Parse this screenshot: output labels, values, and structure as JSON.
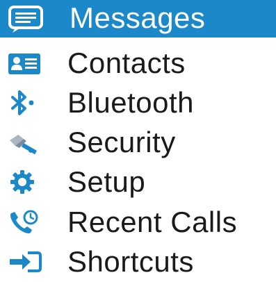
{
  "menu": {
    "accent_color": "#1b89c9",
    "icon_color": "#1b89c9",
    "items": [
      {
        "label": "Messages",
        "icon": "message-icon",
        "selected": true
      },
      {
        "label": "Contacts",
        "icon": "contact-card-icon",
        "selected": false
      },
      {
        "label": "Bluetooth",
        "icon": "bluetooth-icon",
        "selected": false
      },
      {
        "label": "Security",
        "icon": "key-icon",
        "selected": false
      },
      {
        "label": "Setup",
        "icon": "gear-icon",
        "selected": false
      },
      {
        "label": "Recent Calls",
        "icon": "recent-calls-icon",
        "selected": false
      },
      {
        "label": "Shortcuts",
        "icon": "shortcut-arrow-icon",
        "selected": false
      }
    ]
  }
}
